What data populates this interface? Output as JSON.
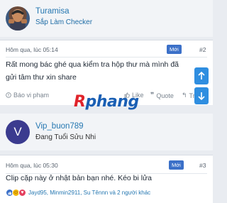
{
  "post1": {
    "username": "Turamisa",
    "user_title": "Sắp Làm Checker",
    "timestamp": "Hôm qua, lúc 05:14",
    "new_badge": "Mới",
    "post_number": "#2",
    "text": "Rất mong bác ghé qua kiểm tra hộp thư mà mình đã gửi tâm thư xin share",
    "actions": {
      "report": "Báo vi phạm",
      "like": "Like",
      "quote": "Quote",
      "reply": "Tr"
    }
  },
  "post2": {
    "username": "Vip_buon789",
    "avatar_letter": "V",
    "user_title": "Đang Tuổi Sửu Nhi",
    "timestamp": "Hôm qua, lúc 05:30",
    "new_badge": "Mới",
    "post_number": "#3",
    "text": "Clip cặp này ở nhật bản bạn nhé. Kéo bi lửa",
    "reactions_summary": "Jayd95, Minmin2911, Su Tênnn và 2 người khác"
  },
  "watermark": {
    "part1": "R",
    "part2": "phang"
  },
  "colors": {
    "accent": "#2577b1",
    "new_badge": "#3b70c8",
    "scroll_button": "#2f8ee0",
    "watermark_red": "#e0242b",
    "watermark_blue": "#1a5fb4"
  },
  "icons": {
    "scroll_up": "arrow-up-icon",
    "scroll_down": "arrow-down-icon",
    "report": "alert-icon",
    "like": "thumbs-up-icon",
    "quote": "quote-icon",
    "reply": "reply-icon"
  }
}
